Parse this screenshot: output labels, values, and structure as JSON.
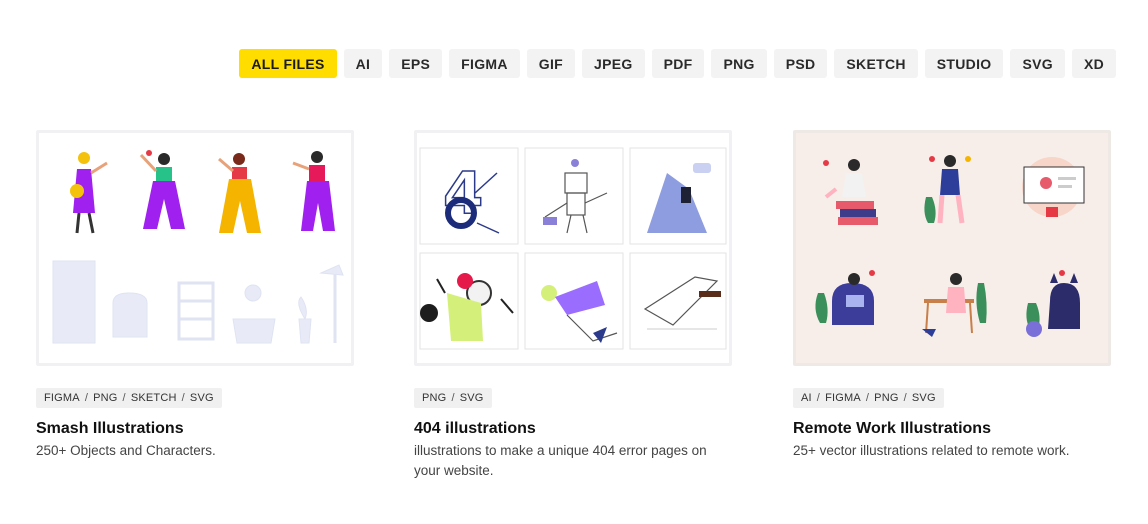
{
  "filters": [
    {
      "label": "ALL FILES",
      "active": true
    },
    {
      "label": "AI"
    },
    {
      "label": "EPS"
    },
    {
      "label": "FIGMA"
    },
    {
      "label": "GIF"
    },
    {
      "label": "JPEG"
    },
    {
      "label": "PDF"
    },
    {
      "label": "PNG"
    },
    {
      "label": "PSD"
    },
    {
      "label": "SKETCH"
    },
    {
      "label": "STUDIO"
    },
    {
      "label": "SVG"
    },
    {
      "label": "XD"
    }
  ],
  "colors": {
    "accent": "#ffdd00",
    "chip_bg": "#f3f3f3",
    "remote_bg": "#f7eee9"
  },
  "cards": [
    {
      "title": "Smash Illustrations",
      "description": "250+ Objects and Characters.",
      "tags": [
        "FIGMA",
        "PNG",
        "SKETCH",
        "SVG"
      ]
    },
    {
      "title": "404 illustrations",
      "description": "illustrations to make a unique 404 error pages on your website.",
      "tags": [
        "PNG",
        "SVG"
      ]
    },
    {
      "title": "Remote Work Illustrations",
      "description": "25+ vector illustrations related to remote work.",
      "tags": [
        "AI",
        "FIGMA",
        "PNG",
        "SVG"
      ]
    }
  ]
}
